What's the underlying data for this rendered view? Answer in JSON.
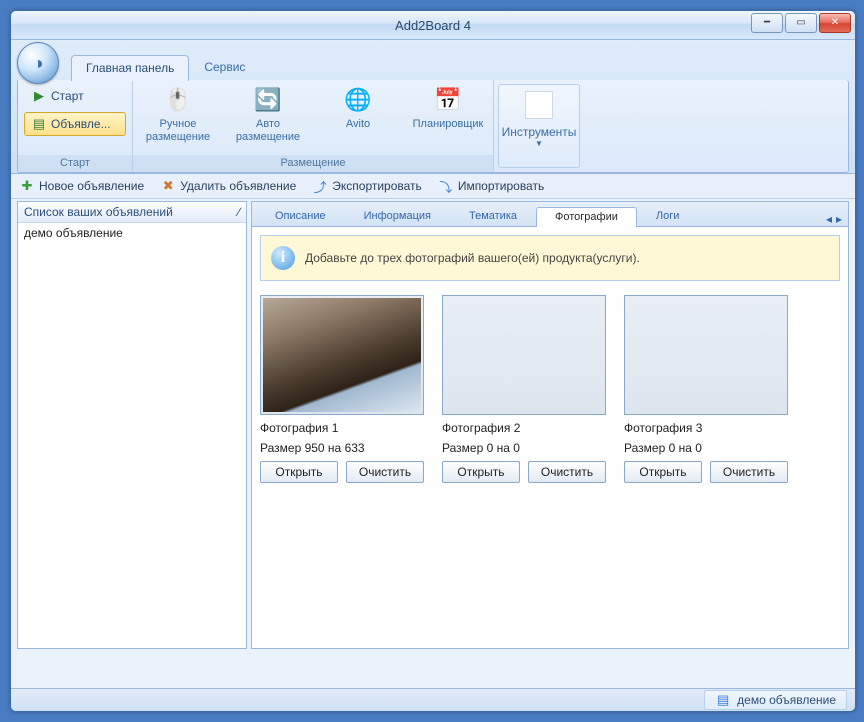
{
  "window": {
    "title": "Add2Board 4"
  },
  "ribbon": {
    "tab_main": "Главная панель",
    "tab_service": "Сервис",
    "group_start": {
      "start": "Старт",
      "ads": "Объявле...",
      "label": "Старт"
    },
    "group_place": {
      "manual": "Ручное\nразмещение",
      "auto": "Авто\nразмещение",
      "avito": "Avito",
      "scheduler": "Планировщик",
      "label": "Размещение"
    },
    "tools": "Инструменты"
  },
  "toolbar": {
    "new": "Новое объявление",
    "delete": "Удалить объявление",
    "export": "Экспортировать",
    "import": "Импортировать"
  },
  "side": {
    "header": "Список ваших объявлений",
    "item": "демо объявление"
  },
  "main_tabs": {
    "desc": "Описание",
    "info": "Информация",
    "theme": "Тематика",
    "photos": "Фотографии",
    "logs": "Логи"
  },
  "infobar": "Добавьте до трех фотографий вашего(ей) продукта(услуги).",
  "photos": [
    {
      "title": "Фотография 1",
      "size": "Размер 950 на 633",
      "has_image": true
    },
    {
      "title": "Фотография 2",
      "size": "Размер 0 на 0",
      "has_image": false
    },
    {
      "title": "Фотография 3",
      "size": "Размер 0 на 0",
      "has_image": false
    }
  ],
  "buttons": {
    "open": "Открыть",
    "clear": "Очистить"
  },
  "status": "демо объявление"
}
